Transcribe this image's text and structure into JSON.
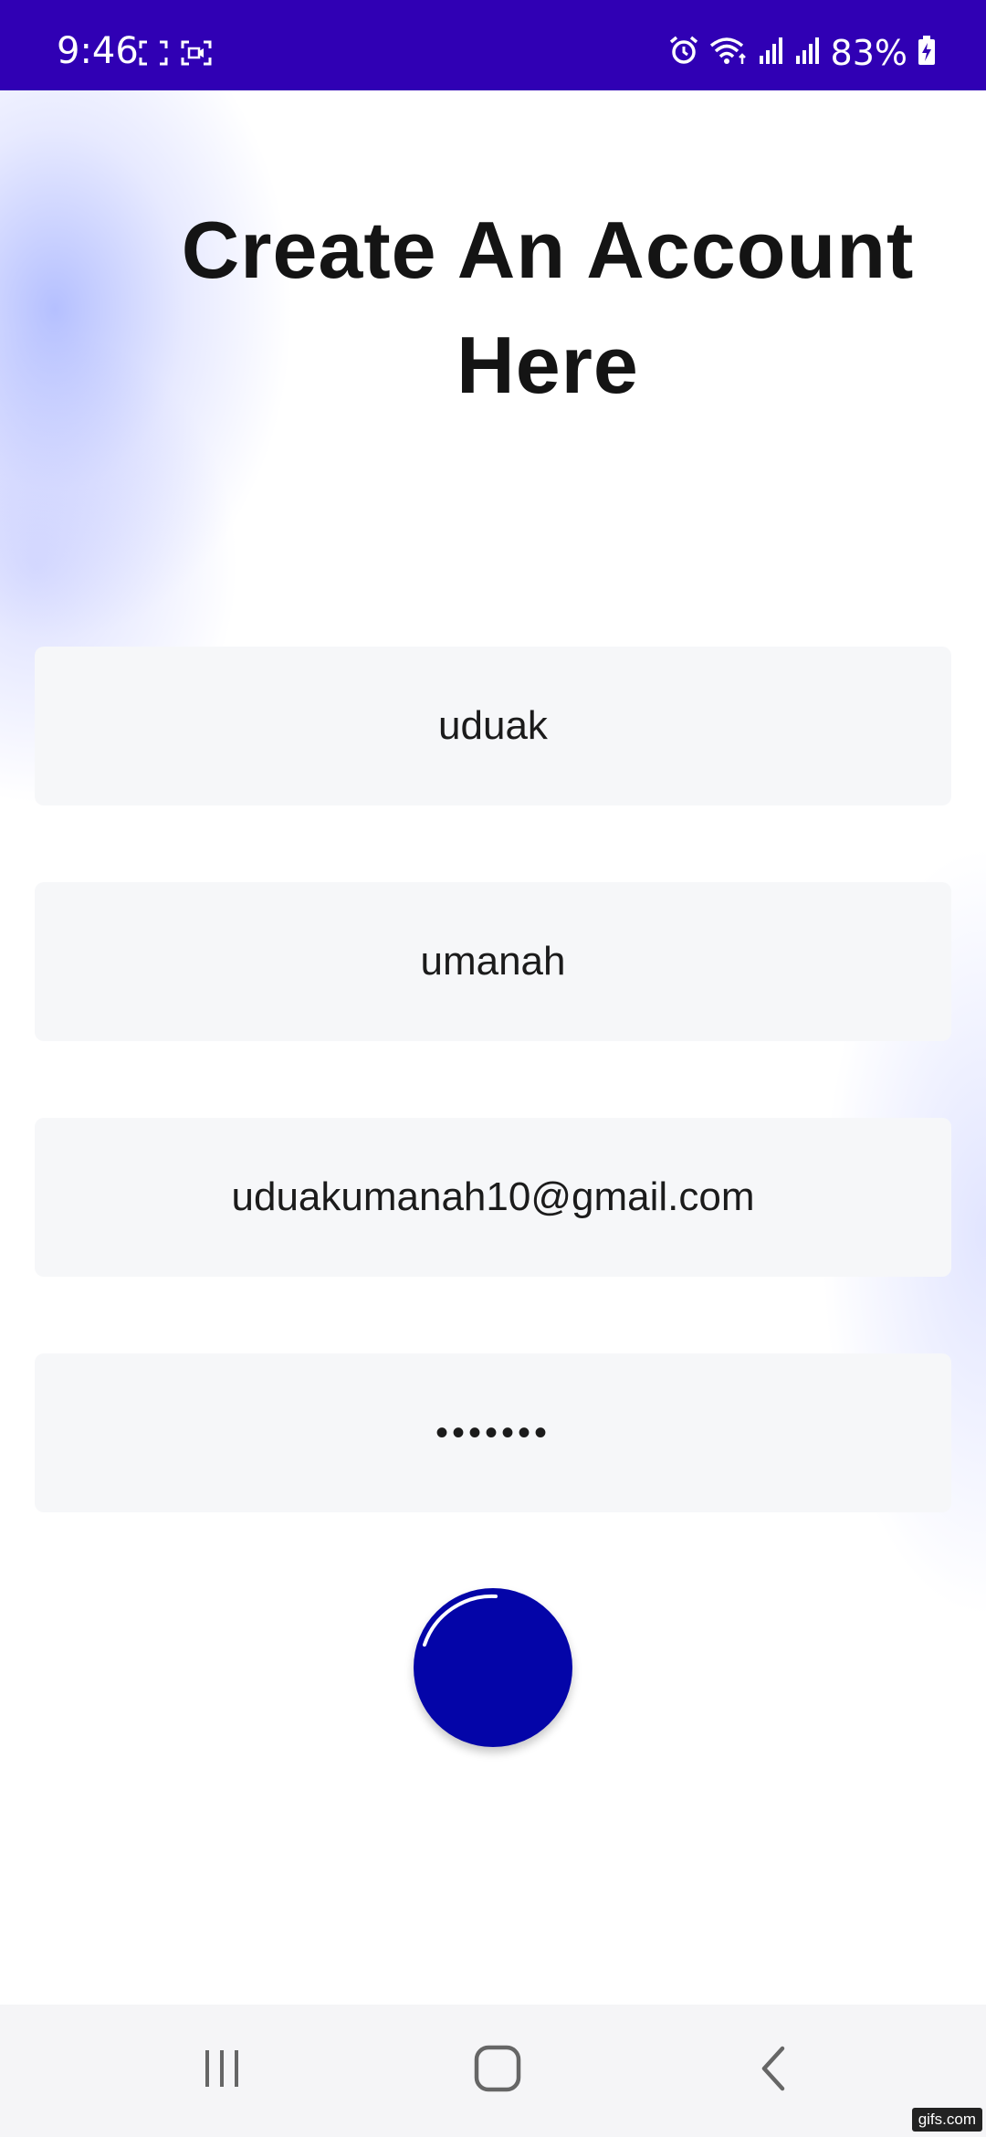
{
  "status_bar": {
    "time": "9:46",
    "battery": "83%",
    "icons": [
      "screenshot-icon",
      "screen-record-icon",
      "alarm-icon",
      "wifi-icon",
      "signal-icon",
      "signal-icon",
      "battery-charging-icon"
    ]
  },
  "form": {
    "title": "Create An Account Here",
    "first_name": "uduak",
    "last_name": "umanah",
    "email": "uduakumanah10@gmail.com",
    "password": "•••••••",
    "submit_state": "loading"
  },
  "nav": {
    "icons": [
      "recent-apps-icon",
      "home-icon",
      "back-icon"
    ]
  },
  "watermark": "gifs.com",
  "colors": {
    "status_bar": "#3000b4",
    "accent": "#0405a8",
    "field_bg": "#f6f7f9",
    "text": "#141414"
  }
}
